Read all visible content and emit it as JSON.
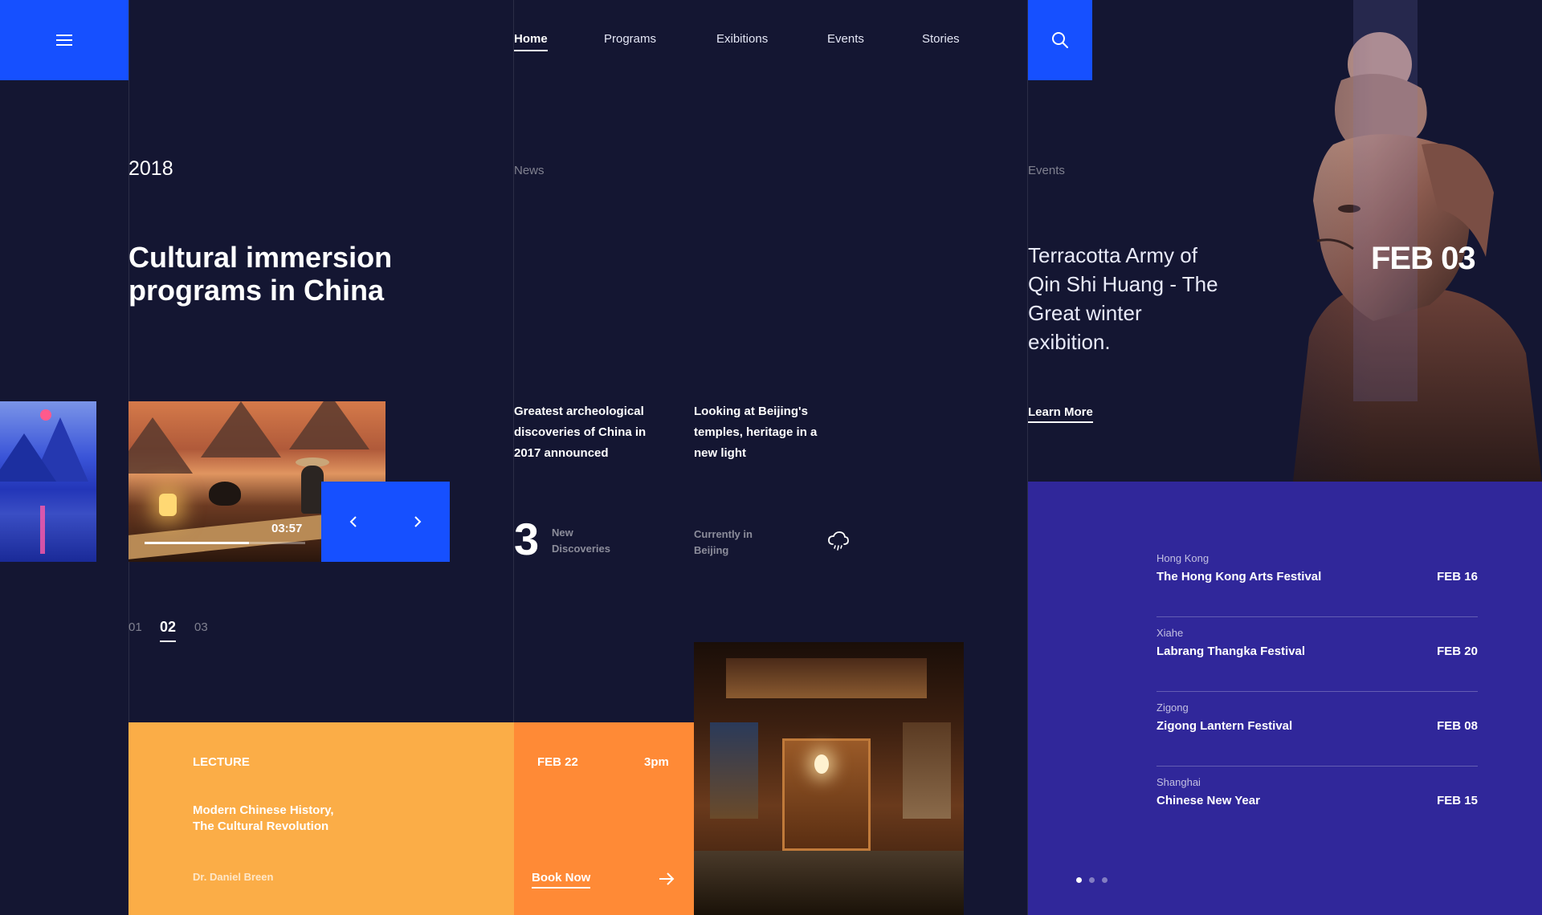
{
  "nav": {
    "items": [
      {
        "label": "Home",
        "active": true
      },
      {
        "label": "Programs",
        "active": false
      },
      {
        "label": "Exibitions",
        "active": false
      },
      {
        "label": "Events",
        "active": false
      },
      {
        "label": "Stories",
        "active": false
      }
    ]
  },
  "hero": {
    "year": "2018",
    "title": "Cultural immersion programs in China",
    "video_time": "03:57",
    "video_progress": 0.65,
    "pager": [
      "01",
      "02",
      "03"
    ],
    "pager_active": "02"
  },
  "news": {
    "label": "News",
    "articles": [
      "Greatest archeological discoveries of China in 2017 announced",
      "Looking at Beijing's temples, heritage in a new light"
    ],
    "stat_number": "3",
    "stat_label_line1": "New",
    "stat_label_line2": "Discoveries",
    "weather_label_line1": "Currently in",
    "weather_label_line2": "Beijing",
    "weather_icon": "cloud-rain-icon"
  },
  "lecture": {
    "type": "LECTURE",
    "title_line1": "Modern Chinese History,",
    "title_line2": "The Cultural Revolution",
    "speaker": "Dr. Daniel Breen",
    "date": "FEB 22",
    "time": "3pm",
    "cta": "Book Now"
  },
  "featured_event": {
    "label": "Events",
    "title": "Terracotta Army of Qin Shi Huang - The Great winter exibition.",
    "cta": "Learn More",
    "date": "FEB 03"
  },
  "events": [
    {
      "city": "Hong Kong",
      "name": "The Hong Kong Arts Festival",
      "date": "FEB 16"
    },
    {
      "city": "Xiahe",
      "name": "Labrang Thangka Festival",
      "date": "FEB 20"
    },
    {
      "city": "Zigong",
      "name": "Zigong Lantern Festival",
      "date": "FEB 08"
    },
    {
      "city": "Shanghai",
      "name": "Chinese New Year",
      "date": "FEB 15"
    }
  ],
  "events_pager": {
    "count": 3,
    "active": 0
  },
  "colors": {
    "background": "#141632",
    "accent_blue": "#1650ff",
    "lecture_yellow": "#fbad47",
    "booking_orange": "#ff8a36",
    "events_purple": "#30279a"
  }
}
